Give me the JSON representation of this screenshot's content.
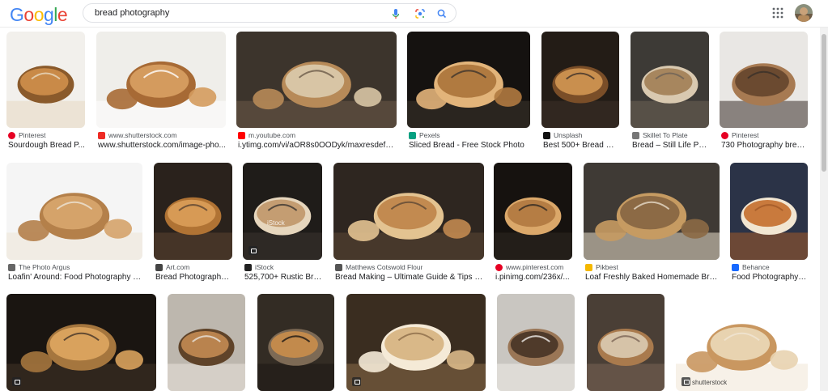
{
  "header": {
    "logo_letters": [
      {
        "ch": "G",
        "color": "#4285f4"
      },
      {
        "ch": "o",
        "color": "#ea4335"
      },
      {
        "ch": "o",
        "color": "#fbbc05"
      },
      {
        "ch": "g",
        "color": "#4285f4"
      },
      {
        "ch": "l",
        "color": "#34a853"
      },
      {
        "ch": "e",
        "color": "#ea4335"
      }
    ],
    "search_query": "bread photography",
    "icons": [
      "mic-icon",
      "lens-icon",
      "search-icon",
      "apps-grid-icon"
    ]
  },
  "results": [
    {
      "source": "Pinterest",
      "title": "Sourdough Bread P...",
      "icon": "pinterest-icon",
      "icon_color": "#e60023"
    },
    {
      "source": "www.shutterstock.com",
      "title": "www.shutterstock.com/image-pho...",
      "icon": "shutterstock-icon",
      "icon_color": "#ee2b24"
    },
    {
      "source": "m.youtube.com",
      "title": "i.ytimg.com/vi/aOR8s0OODyk/maxresdefa...",
      "icon": "youtube-icon",
      "icon_color": "#ff0000"
    },
    {
      "source": "Pexels",
      "title": "Sliced Bread - Free Stock Photo",
      "icon": "pexels-icon",
      "icon_color": "#05a081"
    },
    {
      "source": "Unsplash",
      "title": "Best 500+ Bread Pi...",
      "icon": "unsplash-icon",
      "icon_color": "#111111"
    },
    {
      "source": "Skillet To Plate",
      "title": "Bread – Still Life Ph...",
      "icon": "skillet-icon",
      "icon_color": "#777777"
    },
    {
      "source": "Pinterest",
      "title": "730 Photography brea...",
      "icon": "pinterest-icon",
      "icon_color": "#e60023"
    },
    {
      "source": "The Photo Argus",
      "title": "Loafin' Around: Food Photography Ti...",
      "icon": "photo-argus-icon",
      "icon_color": "#666666"
    },
    {
      "source": "Art.com",
      "title": "Bread Photography ...",
      "icon": "art-com-icon",
      "icon_color": "#444444"
    },
    {
      "source": "iStock",
      "title": "525,700+ Rustic Bre...",
      "icon": "istock-icon",
      "icon_color": "#222222"
    },
    {
      "source": "Matthews Cotswold Flour",
      "title": "Bread Making – Ultimate Guide & Tips o...",
      "icon": "matthews-icon",
      "icon_color": "#555555"
    },
    {
      "source": "www.pinterest.com",
      "title": "i.pinimg.com/236x/...",
      "icon": "pinterest-icon",
      "icon_color": "#e60023"
    },
    {
      "source": "Pikbest",
      "title": "Loaf Freshly Baked Homemade Bre...",
      "icon": "pikbest-icon",
      "icon_color": "#f5b800"
    },
    {
      "source": "Behance",
      "title": "Food Photography :...",
      "icon": "behance-icon",
      "icon_color": "#1769ff"
    },
    {
      "source": "",
      "title": "",
      "icon": "",
      "icon_color": ""
    },
    {
      "source": "",
      "title": "",
      "icon": "",
      "icon_color": ""
    },
    {
      "source": "",
      "title": "",
      "icon": "",
      "icon_color": ""
    },
    {
      "source": "",
      "title": "",
      "icon": "",
      "icon_color": ""
    },
    {
      "source": "",
      "title": "",
      "icon": "",
      "icon_color": ""
    },
    {
      "source": "",
      "title": "",
      "icon": "",
      "icon_color": ""
    },
    {
      "source": "",
      "title": "",
      "icon": "",
      "icon_color": ""
    }
  ],
  "thumb_watermarks": {
    "istock": "iStock",
    "shutterstock": "shutterstock"
  }
}
